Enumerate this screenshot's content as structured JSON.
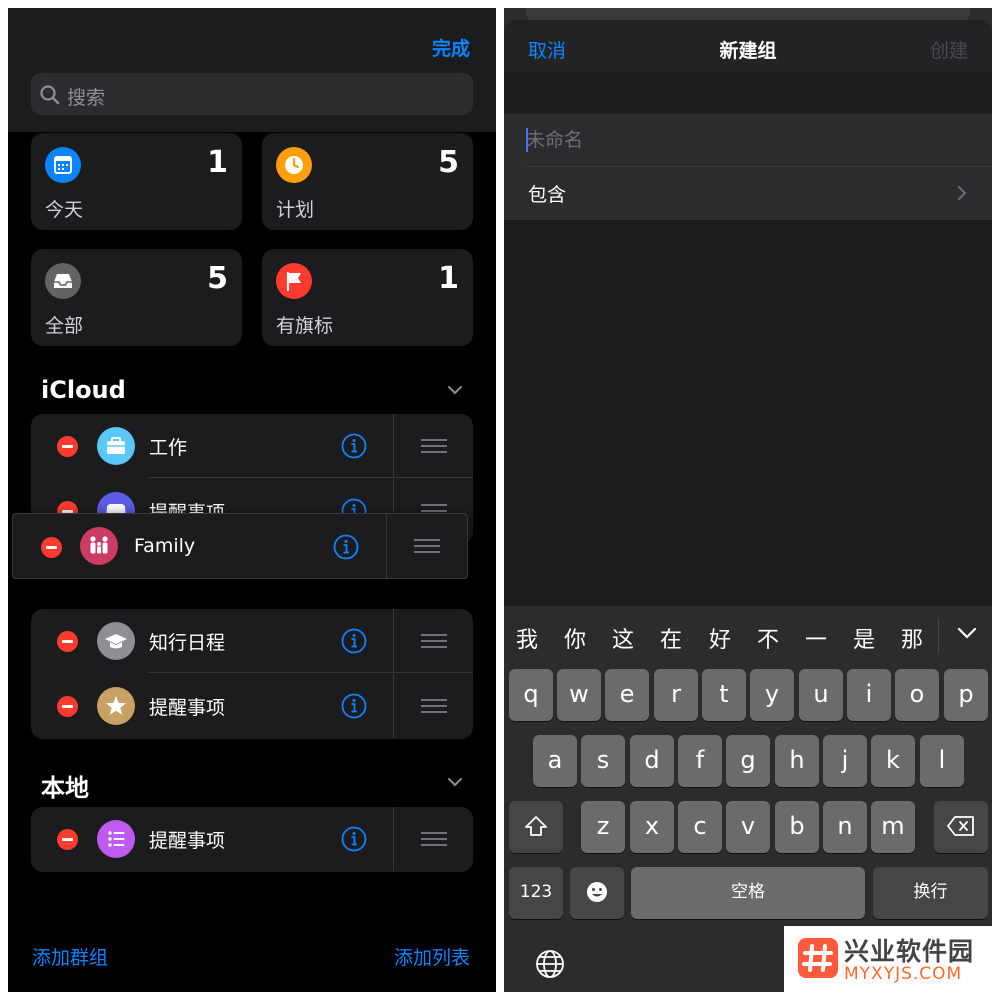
{
  "left": {
    "done": "完成",
    "search_placeholder": "搜索",
    "cards": [
      {
        "label": "今天",
        "count": "1",
        "color": "#0a84ff",
        "icon": "calendar-icon"
      },
      {
        "label": "计划",
        "count": "5",
        "color": "#ff9f0a",
        "icon": "clock-icon"
      },
      {
        "label": "全部",
        "count": "5",
        "color": "#636366",
        "icon": "tray-icon"
      },
      {
        "label": "有旗标",
        "count": "1",
        "color": "#ff3b30",
        "icon": "flag-icon"
      }
    ],
    "icloud_title": "iCloud",
    "icloud_lists": [
      {
        "name": "工作",
        "color": "#5ac8fa",
        "icon": "briefcase-icon"
      },
      {
        "name": "提醒事项",
        "color": "#5e5ce6",
        "icon": "gamepad-icon"
      },
      {
        "name": "知行日程",
        "color": "#8e8e93",
        "icon": "graduation-cap-icon"
      },
      {
        "name": "提醒事项",
        "color": "#c8a165",
        "icon": "star-icon"
      }
    ],
    "dragging": {
      "name": "Family",
      "color": "#cc3b63",
      "icon": "family-icon"
    },
    "local_title": "本地",
    "local_lists": [
      {
        "name": "提醒事项",
        "color": "#bf5af2",
        "icon": "list-icon"
      }
    ],
    "add_group": "添加群组",
    "add_list": "添加列表"
  },
  "right": {
    "cancel": "取消",
    "title": "新建组",
    "create": "创建",
    "name_placeholder": "未命名",
    "include": "包含",
    "candidates": [
      "我",
      "你",
      "这",
      "在",
      "好",
      "不",
      "一",
      "是",
      "那"
    ],
    "row1": [
      "q",
      "w",
      "e",
      "r",
      "t",
      "y",
      "u",
      "i",
      "o",
      "p"
    ],
    "row2": [
      "a",
      "s",
      "d",
      "f",
      "g",
      "h",
      "j",
      "k",
      "l"
    ],
    "row3": [
      "z",
      "x",
      "c",
      "v",
      "b",
      "n",
      "m"
    ],
    "num_key": "123",
    "space": "空格",
    "return": "换行"
  },
  "watermark": {
    "cn": "兴业软件园",
    "en": "MYXYJS.COM"
  }
}
